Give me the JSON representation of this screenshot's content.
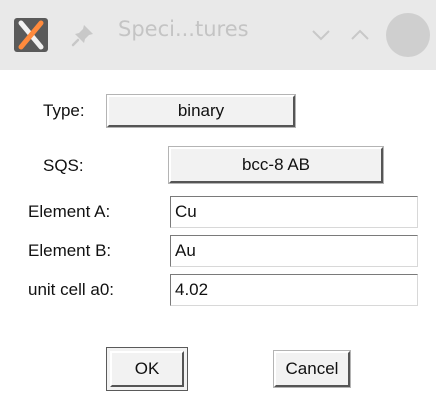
{
  "window": {
    "title": "Speci...tures"
  },
  "icons": {
    "app": "x-window-icon",
    "pin": "pin-icon",
    "minimize": "chevron-down-icon",
    "maximize": "chevron-up-icon",
    "close": "close-circle-icon"
  },
  "form": {
    "type_label": "Type:",
    "type_value": "binary",
    "sqs_label": "SQS:",
    "sqs_value": "bcc-8 AB",
    "element_a_label": "Element A:",
    "element_a_value": "Cu",
    "element_b_label": "Element B:",
    "element_b_value": "Au",
    "unit_cell_label": "unit cell a0:",
    "unit_cell_value": "4.02"
  },
  "buttons": {
    "ok_label": "OK",
    "cancel_label": "Cancel"
  }
}
